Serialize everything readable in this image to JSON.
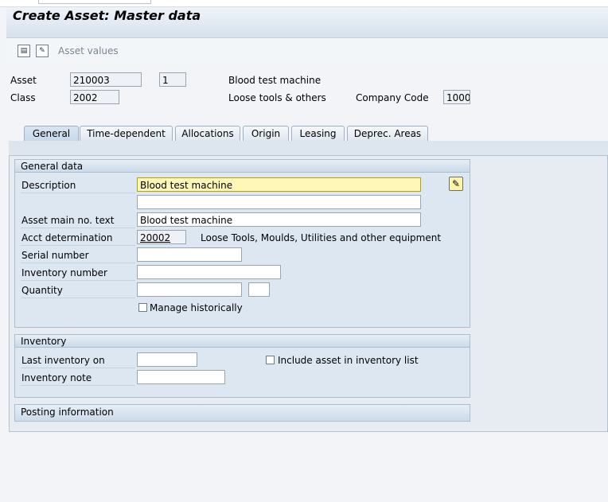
{
  "window": {
    "title": "Create Asset: Master data"
  },
  "toolbar": {
    "icons": [
      "document-icon",
      "document-new-icon"
    ],
    "asset_values_label": "Asset values"
  },
  "header": {
    "asset_label": "Asset",
    "asset_number": "210003",
    "asset_subnumber": "1",
    "asset_description": "Blood test machine",
    "class_label": "Class",
    "class_value": "2002",
    "class_description": "Loose tools & others",
    "company_code_label": "Company Code",
    "company_code_value": "1000"
  },
  "tabs": [
    {
      "label": "General"
    },
    {
      "label": "Time-dependent"
    },
    {
      "label": "Allocations"
    },
    {
      "label": "Origin"
    },
    {
      "label": "Leasing"
    },
    {
      "label": "Deprec. Areas"
    }
  ],
  "general_data": {
    "title": "General data",
    "description_label": "Description",
    "description_value": "Blood test machine",
    "description_line2": "",
    "asset_main_text_label": "Asset main no. text",
    "asset_main_text_value": "Blood test machine",
    "acct_determination_label": "Acct determination",
    "acct_determination_value": "20002",
    "acct_determination_text": "Loose Tools, Moulds, Utilities and other equipment",
    "serial_number_label": "Serial number",
    "serial_number_value": "",
    "inventory_number_label": "Inventory number",
    "inventory_number_value": "",
    "quantity_label": "Quantity",
    "quantity_value": "",
    "quantity_unit": "",
    "manage_historically_label": "Manage historically"
  },
  "inventory": {
    "title": "Inventory",
    "last_inventory_label": "Last inventory on",
    "last_inventory_value": "",
    "include_asset_label": "Include asset in inventory list",
    "inventory_note_label": "Inventory note",
    "inventory_note_value": ""
  },
  "posting": {
    "title": "Posting information"
  }
}
